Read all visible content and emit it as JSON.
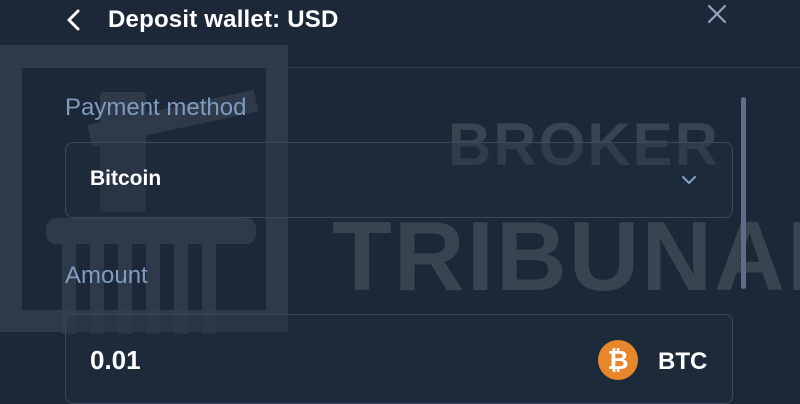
{
  "header": {
    "title": "Deposit wallet: USD",
    "back_icon": "chevron-left-icon",
    "close_icon": "close-icon"
  },
  "payment_method": {
    "label": "Payment method",
    "selected": "Bitcoin"
  },
  "amount": {
    "label": "Amount",
    "value": "0.01",
    "currency": "BTC",
    "currency_icon": "bitcoin-icon",
    "currency_icon_glyph": "₿"
  },
  "watermark": {
    "line1": "BROKER",
    "line2": "TRIBUNAL"
  },
  "colors": {
    "background": "#1c2838",
    "label": "#7f9bbd",
    "border": "#3a4a5e",
    "bitcoin": "#e8872a"
  }
}
